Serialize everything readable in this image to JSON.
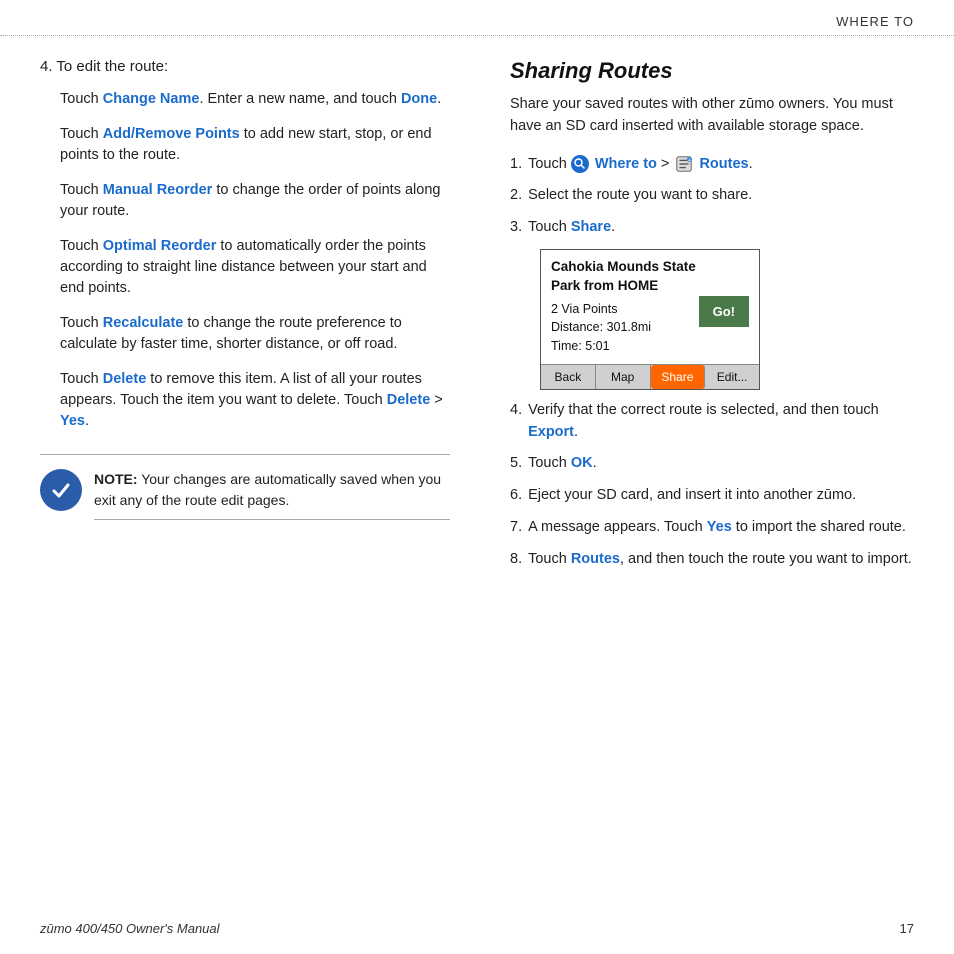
{
  "header": {
    "title": "Where To"
  },
  "left": {
    "step4_header": "4. To edit the route:",
    "touch_items": [
      {
        "keyword": "Change Name",
        "text": ". Enter a new name, and touch ",
        "keyword2": "Done",
        "text2": "."
      },
      {
        "keyword": "Add/Remove Points",
        "text": " to add new start, stop, or end points to the route."
      },
      {
        "keyword": "Manual Reorder",
        "text": " to change the order of points along your route."
      },
      {
        "keyword": "Optimal Reorder",
        "text": " to automatically order the points according to straight line distance between your start and end points."
      },
      {
        "keyword": "Recalculate",
        "text": " to change the route preference to calculate by faster time, shorter distance, or off road."
      },
      {
        "keyword": "Delete",
        "text": " to remove this item. A list of all your routes appears. Touch the item you want to delete. Touch ",
        "keyword2": "Delete",
        "text2": " > ",
        "keyword3": "Yes",
        "text3": "."
      }
    ],
    "note": {
      "bold": "NOTE:",
      "text": " Your changes are automatically saved when you exit any of the route edit pages."
    }
  },
  "right": {
    "section_title": "Sharing Routes",
    "section_desc": "Share your saved routes with other zūmo owners. You must have an SD card inserted with available storage space.",
    "steps": [
      {
        "num": "1.",
        "pre": "Touch ",
        "keyword": "Where to",
        "mid": " > ",
        "keyword2": "Routes",
        "post": "."
      },
      {
        "num": "2.",
        "text": "Select the route you want to share."
      },
      {
        "num": "3.",
        "pre": "Touch ",
        "keyword": "Share",
        "post": "."
      }
    ],
    "screenshot": {
      "title": "Cahokia Mounds State Park from HOME",
      "details": "2 Via Points\nDistance: 301.8mi\nTime: 5:01",
      "go_btn": "Go!",
      "buttons": [
        "Back",
        "Map",
        "Share",
        "Edit..."
      ]
    },
    "steps_after": [
      {
        "num": "4.",
        "pre": "Verify that the correct route is selected, and then touch ",
        "keyword": "Export",
        "post": "."
      },
      {
        "num": "5.",
        "pre": "Touch ",
        "keyword": "OK",
        "post": "."
      },
      {
        "num": "6.",
        "text": "Eject your SD card, and insert it into another zūmo."
      },
      {
        "num": "7.",
        "pre": "A message appears. Touch ",
        "keyword": "Yes",
        "post": " to import the shared route."
      },
      {
        "num": "8.",
        "pre": "Touch ",
        "keyword": "Routes",
        "post": ", and then touch the route you want to import."
      }
    ]
  },
  "footer": {
    "manual": "zūmo 400/450 Owner's Manual",
    "page": "17"
  }
}
